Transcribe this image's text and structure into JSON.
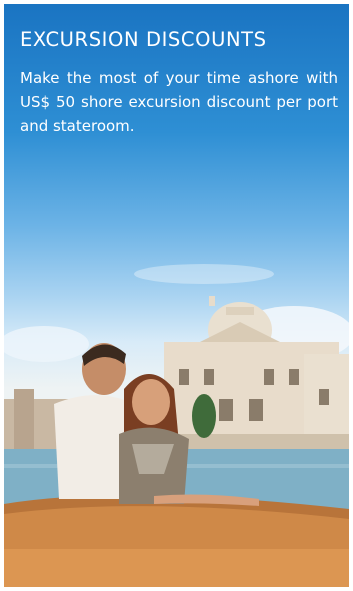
{
  "promo": {
    "title": "EXCURSION DISCOUNTS",
    "description": "Make the most of your time ashore with US$ 50 shore excursion discount per port and stateroom."
  },
  "colors": {
    "sky_top": "#1a74c2",
    "sky_bottom": "#d8ebf8",
    "text": "#ffffff"
  }
}
